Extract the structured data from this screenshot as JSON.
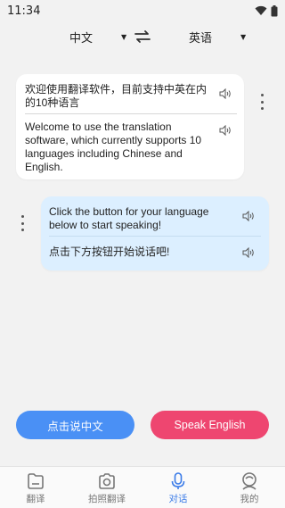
{
  "status": {
    "time": "11:34"
  },
  "lang": {
    "source": "中文",
    "target": "英语"
  },
  "conversation": [
    {
      "zh": "欢迎使用翻译软件，目前支持中英在内的10种语言",
      "en": "Welcome to use the translation software, which currently supports 10 languages including Chinese and English."
    },
    {
      "en": "Click the button for your language below to start speaking!",
      "zh": "点击下方按钮开始说话吧!"
    }
  ],
  "buttons": {
    "speak_chinese": "点击说中文",
    "speak_english": "Speak English"
  },
  "tabs": [
    {
      "label": "翻译",
      "icon": "folder-icon",
      "active": false
    },
    {
      "label": "拍照翻译",
      "icon": "camera-icon",
      "active": false
    },
    {
      "label": "对话",
      "icon": "microphone-icon",
      "active": true
    },
    {
      "label": "我的",
      "icon": "profile-icon",
      "active": false
    }
  ],
  "colors": {
    "accent": "#3a7be8",
    "chinese_button": "#4a90f5",
    "english_button": "#ee4670",
    "right_bubble": "#dcefff"
  }
}
